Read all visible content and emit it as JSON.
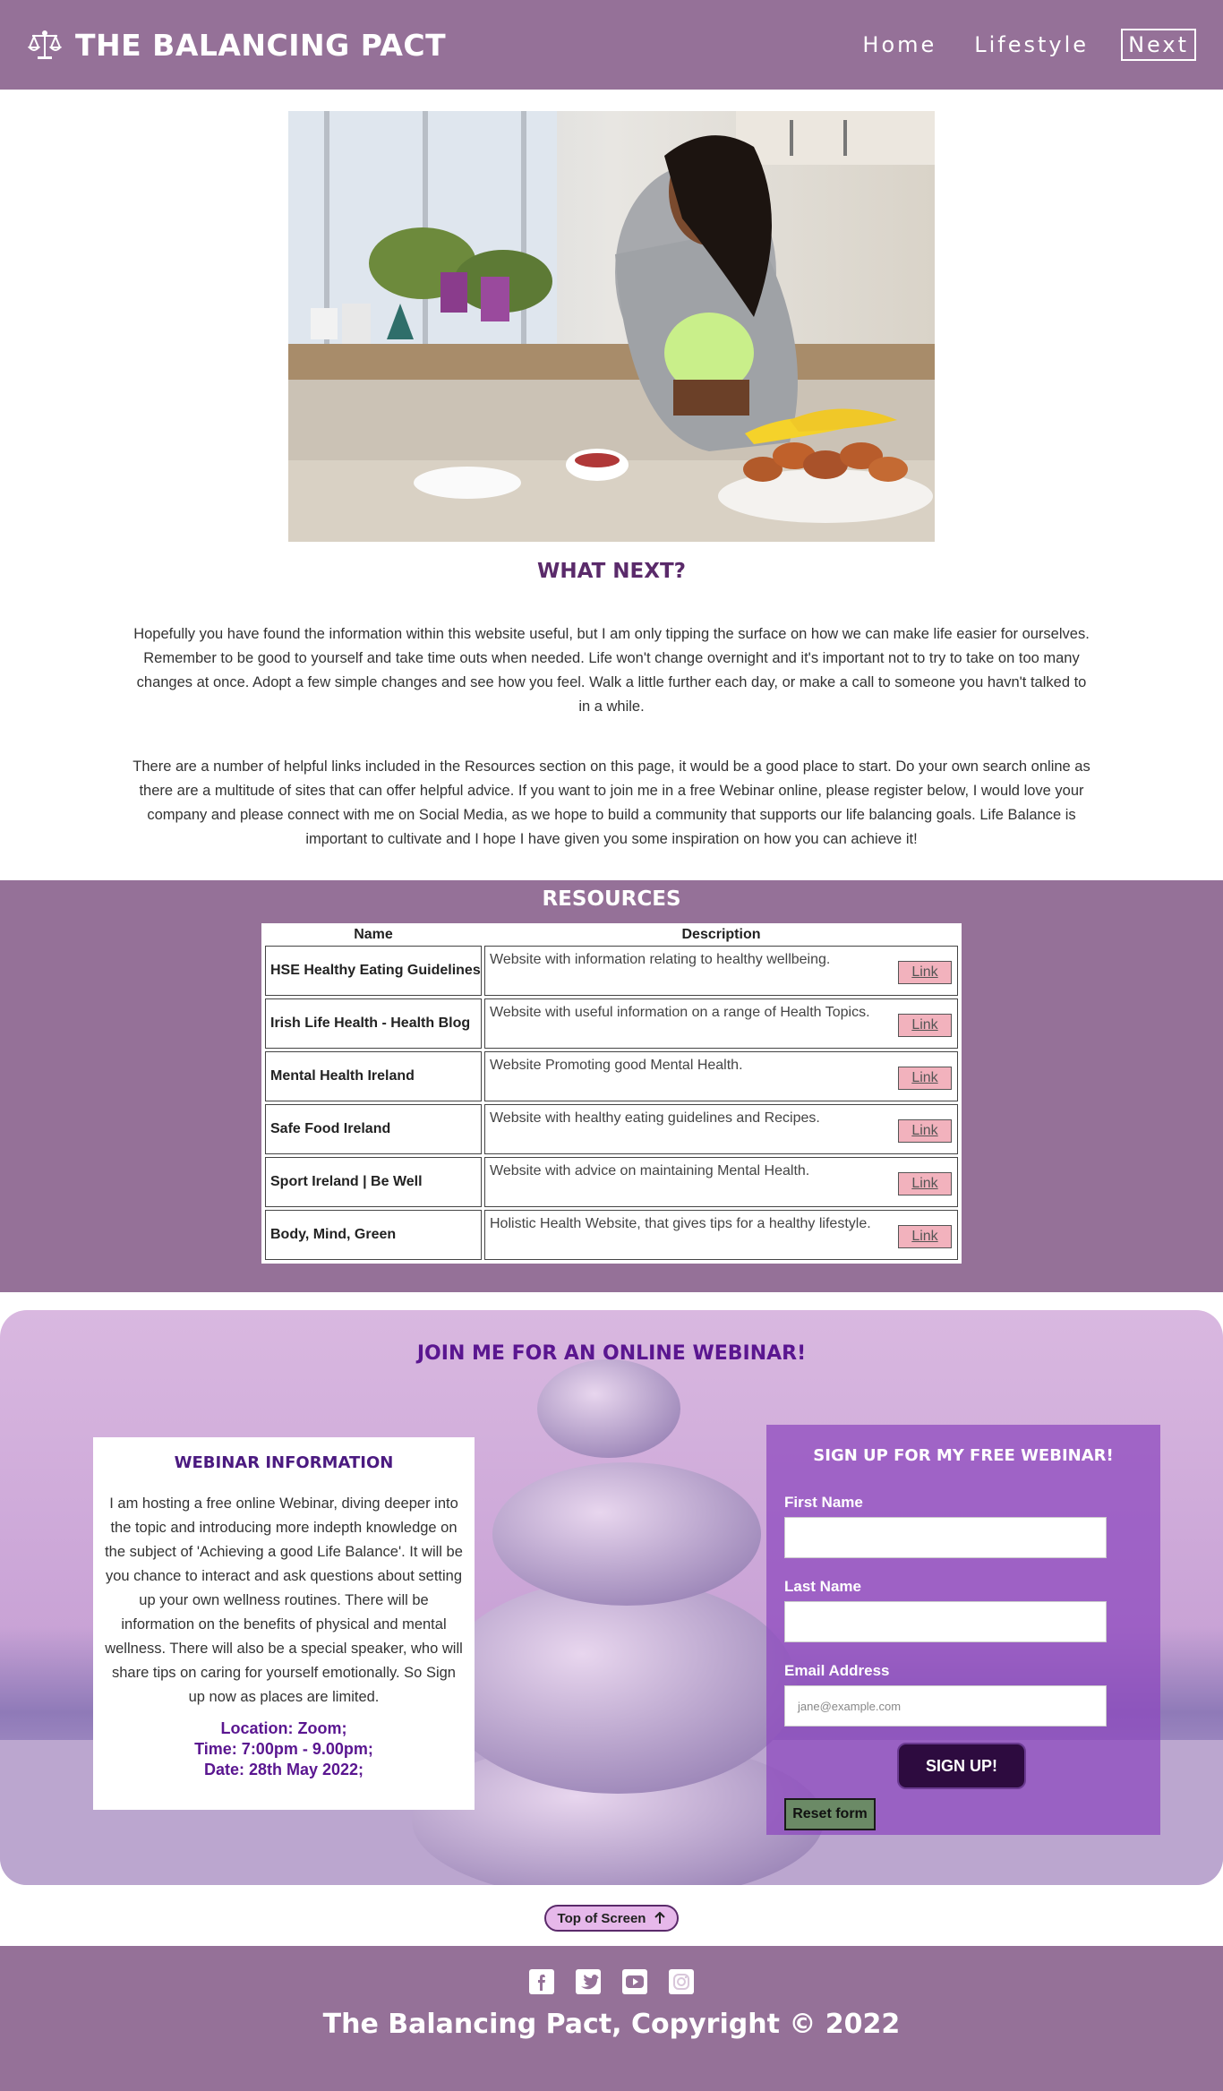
{
  "header": {
    "brand_icon": "balance-scale-icon",
    "brand_title": "THE BALANCING PACT",
    "nav": [
      {
        "label": "Home",
        "active": false
      },
      {
        "label": "Lifestyle",
        "active": false
      },
      {
        "label": "Next",
        "active": true
      }
    ]
  },
  "what_next": {
    "title": "WHAT NEXT?",
    "paragraph_1": "Hopefully you have found the information within this website useful, but I am only tipping the surface on how we can make life easier for ourselves. Remember to be good to yourself and take time outs when needed. Life won't change overnight and it's important not to try to take on too many changes at once. Adopt a few simple changes and see how you feel. Walk a little further each day, or make a call to someone you havn't talked to in a while.",
    "paragraph_2": "There are a number of helpful links included in the Resources section on this page, it would be a good place to start. Do your own search online as there are a multitude of sites that can offer helpful advice. If you want to join me in a free Webinar online, please register below, I would love your company and please connect with me on Social Media, as we hope to build a community that supports our life balancing goals. Life Balance is important to cultivate and I hope I have given you some inspiration on how you can achieve it!"
  },
  "resources": {
    "title": "RESOURCES",
    "headers": [
      "Name",
      "Description"
    ],
    "link_label": "Link",
    "rows": [
      {
        "name": "HSE Healthy Eating Guidelines",
        "description": "Website with information relating to healthy wellbeing."
      },
      {
        "name": "Irish Life Health - Health Blog",
        "description": "Website with useful information on a range of Health Topics."
      },
      {
        "name": "Mental Health Ireland",
        "description": "Website Promoting good Mental Health."
      },
      {
        "name": "Safe Food Ireland",
        "description": "Website with healthy eating guidelines and Recipes."
      },
      {
        "name": "Sport Ireland | Be Well",
        "description": "Website with advice on maintaining Mental Health."
      },
      {
        "name": "Body, Mind, Green",
        "description": "Holistic Health Website, that gives tips for a healthy lifestyle."
      }
    ]
  },
  "webinar": {
    "title": "JOIN ME FOR AN ONLINE WEBINAR!",
    "info": {
      "title": "WEBINAR INFORMATION",
      "text": "I am hosting a free online Webinar, diving deeper into the topic and introducing more indepth knowledge on the subject of 'Achieving a good Life Balance'. It will be you chance to interact and ask questions about setting up your own wellness routines. There will be information on the benefits of physical and mental wellness. There will also be a special speaker, who will share tips on caring for yourself emotionally. So Sign up now as places are limited.",
      "location": "Location: Zoom;",
      "time": "Time: 7:00pm - 9.00pm;",
      "date": "Date: 28th May 2022;"
    },
    "form": {
      "title": "SIGN UP FOR MY FREE WEBINAR!",
      "first_name_label": "First Name",
      "first_name_value": "",
      "last_name_label": "Last Name",
      "last_name_value": "",
      "email_label": "Email Address",
      "email_placeholder": "jane@example.com",
      "submit_label": "SIGN UP!",
      "reset_label": "Reset form"
    }
  },
  "top_button": {
    "label": "Top of Screen",
    "icon": "arrow-up-icon"
  },
  "footer": {
    "socials": [
      "facebook-icon",
      "twitter-icon",
      "youtube-icon",
      "instagram-icon"
    ],
    "copyright": "The Balancing Pact, Copyright © 2022"
  },
  "colors": {
    "brand_purple": "#957198",
    "heading_purple": "#5a2a6a",
    "link_pink": "#f2b2bd",
    "signup_dark": "#2d0b3f",
    "reset_green": "#6b8a66"
  }
}
